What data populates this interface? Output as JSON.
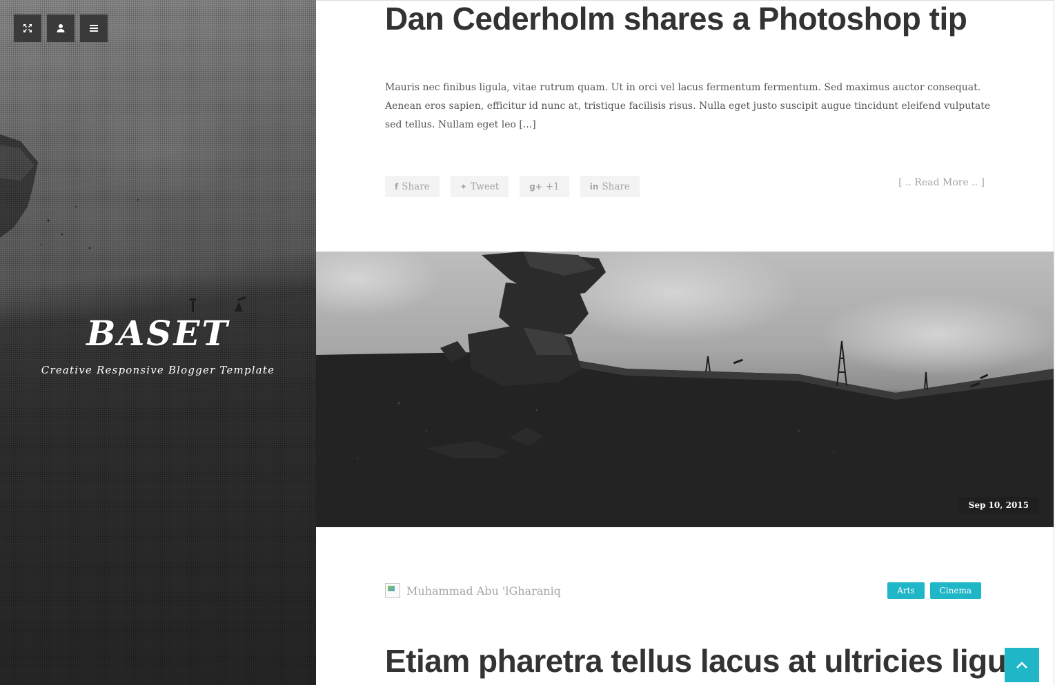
{
  "sidebar": {
    "icons": [
      "expand-icon",
      "user-icon",
      "menu-icon"
    ],
    "title": "BASET",
    "tagline": "Creative Responsive Blogger Template"
  },
  "post1": {
    "title": "Dan Cederholm shares a Photoshop tip",
    "excerpt": "Mauris nec finibus ligula, vitae rutrum quam. Ut in orci vel lacus fermentum fermentum. Sed maximus auctor consequat. Aenean eros sapien, efficitur id nunc at, tristique facilisis risus. Nulla eget justo suscipit augue tincidunt eleifend vulputate sed tellus. Nullam eget leo [...]",
    "share_buttons": [
      {
        "icon": "facebook-icon",
        "glyph": "f",
        "label": "Share"
      },
      {
        "icon": "twitter-icon",
        "glyph": "✦",
        "label": "Tweet"
      },
      {
        "icon": "google-plus-icon",
        "glyph": "g+",
        "label": "+1"
      },
      {
        "icon": "linkedin-icon",
        "glyph": "in",
        "label": "Share"
      }
    ],
    "read_more": "[ .. Read More .. ]"
  },
  "post2": {
    "date": "Sep 10, 2015",
    "author": "Muhammad Abu 'lGharaniq",
    "tags": [
      "Arts",
      "Cinema"
    ],
    "title": "Etiam pharetra tellus lacus at ultricies ligula"
  },
  "colors": {
    "accent": "#1fb6c7",
    "sidebar_bg": "#2d2d2d",
    "title_text": "#333333",
    "muted_text": "#a6a6a6"
  }
}
